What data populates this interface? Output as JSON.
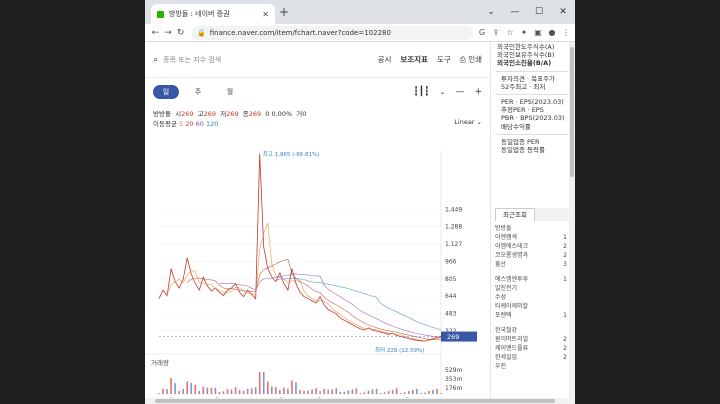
{
  "browser": {
    "tab_title": "방방돌 : 네이버 증권",
    "url": "finance.naver.com/item/fchart.naver?code=102280"
  },
  "toolbar": {
    "search_placeholder": "종목 또는 지수 검색",
    "menu": [
      "공시",
      "보조지표",
      "도구",
      "인쇄"
    ]
  },
  "period": {
    "buttons": [
      "일",
      "주",
      "월"
    ],
    "active": "일"
  },
  "quote": {
    "open_label": "시",
    "open": "269",
    "high_label": "고",
    "high": "269",
    "low_label": "저",
    "low": "269",
    "close_label": "종",
    "close": "269",
    "change": "0 0.00%",
    "volume_label": "거",
    "volume": "0"
  },
  "ma": {
    "label": "이동평균",
    "p5": "5",
    "p20": "20",
    "p60": "60",
    "p120": "120",
    "scale": "Linear"
  },
  "chart_data": {
    "type": "line",
    "price_ticks": [
      1449,
      1288,
      1127,
      966,
      805,
      644,
      483,
      322
    ],
    "x_ticks": [
      "6월",
      "10월",
      "2022",
      "4월",
      "8월",
      "2023",
      "4월"
    ],
    "max_label": "최고 1,965 (-86.81%)",
    "min_label": "최저 228 (12.59%)",
    "current_price": "269",
    "volume_label": "거래량",
    "volume_ticks": [
      "529m",
      "353m",
      "176m"
    ],
    "close": [
      620,
      700,
      650,
      900,
      780,
      720,
      800,
      1000,
      850,
      760,
      700,
      820,
      740,
      690,
      720,
      680,
      650,
      700,
      720,
      760,
      680,
      640,
      700,
      660,
      620,
      1965,
      1100,
      900,
      820,
      780,
      860,
      760,
      700,
      900,
      760,
      680,
      640,
      620,
      600,
      580,
      640,
      560,
      520,
      500,
      480,
      440,
      420,
      400,
      380,
      360,
      340,
      330,
      350,
      330,
      320,
      310,
      300,
      290,
      300,
      280,
      270,
      260,
      250,
      240,
      235,
      230,
      228,
      240,
      250,
      260,
      269
    ]
  },
  "side": {
    "rows1": [
      "외국인한도주식수(A)",
      "외국인보유주식수(B)",
      "외국인소진율(B/A)"
    ],
    "rows2": [
      "투자의견 · 목표주가",
      "52주최고 · 최저"
    ],
    "rows3": [
      "PER · EPS(2023.03)",
      "추정PER · EPS",
      "PBR · BPS(2023.03)",
      "배당수익률"
    ],
    "rows4": [
      "동일업종 PER",
      "동일업종 등락률"
    ],
    "recent_tabs": [
      "최근조회",
      ""
    ],
    "recent": [
      {
        "name": "방방돌",
        "v": ""
      },
      {
        "name": "이엔캠색",
        "v": "1"
      },
      {
        "name": "이엠에스테크",
        "v": "2"
      },
      {
        "name": "코오롱생명과",
        "v": "2"
      },
      {
        "name": "흥산",
        "v": "3"
      },
      {
        "name": "",
        "v": ""
      },
      {
        "name": "에스엠엔투루",
        "v": "1"
      },
      {
        "name": "일진전기",
        "v": ""
      },
      {
        "name": "수성",
        "v": ""
      },
      {
        "name": "티케이케미칼",
        "v": ""
      },
      {
        "name": "포렌텍",
        "v": "1"
      },
      {
        "name": "",
        "v": ""
      },
      {
        "name": "한국철강",
        "v": ""
      },
      {
        "name": "원익머트리얼",
        "v": "2"
      },
      {
        "name": "케이엔드플류",
        "v": "2"
      },
      {
        "name": "한세실업",
        "v": "2"
      },
      {
        "name": "우진",
        "v": ""
      }
    ]
  }
}
